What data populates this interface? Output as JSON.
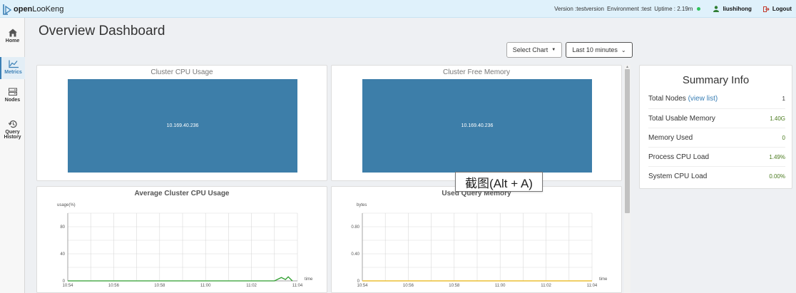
{
  "brand": {
    "name_bold": "open",
    "name_rest": "LooKeng"
  },
  "topbar": {
    "version": "Version :testversion",
    "environment": "Environment :test",
    "uptime": "Uptime : 2.19m",
    "status_color": "#2fc25b",
    "user": "liushihong",
    "logout": "Logout"
  },
  "sidebar": {
    "items": [
      {
        "label": "Home",
        "icon": "home-icon"
      },
      {
        "label": "Metrics",
        "icon": "line-chart-icon",
        "active": true
      },
      {
        "label": "Nodes",
        "icon": "server-icon"
      },
      {
        "label": "Query",
        "label2": "History",
        "icon": "history-icon"
      }
    ]
  },
  "page": {
    "title": "Overview Dashboard"
  },
  "controls": {
    "select_chart": "Select Chart",
    "range": "Last 10 minutes"
  },
  "panels": {
    "cpu_usage": {
      "title": "Cluster CPU Usage",
      "node": "10.169.40.236"
    },
    "free_memory": {
      "title": "Cluster Free Memory",
      "node": "10.169.40.236"
    },
    "avg_cpu": {
      "title": "Average Cluster CPU Usage"
    },
    "used_memory": {
      "title": "Used Query Memory"
    }
  },
  "summary": {
    "title": "Summary Info",
    "rows": [
      {
        "label": "Total Nodes",
        "link": "(view list)",
        "value": "1"
      },
      {
        "label": "Total Usable Memory",
        "value": "1.40G"
      },
      {
        "label": "Memory Used",
        "value": "0"
      },
      {
        "label": "Process CPU Load",
        "value": "1.49%"
      },
      {
        "label": "System CPU Load",
        "value": "0.00%"
      }
    ]
  },
  "tooltip": {
    "text": "截图(Alt + A)"
  },
  "colors": {
    "accent": "#3d7ea9",
    "series_green": "#2e9e2e",
    "series_yellow": "#e8b20c"
  },
  "chart_data": [
    {
      "type": "line",
      "ylabel": "usage(%)",
      "xlabel": "time",
      "x": [
        "10:54",
        "10:56",
        "10:58",
        "11:00",
        "11:02",
        "11:04"
      ],
      "yticks": [
        "0",
        "40",
        "80"
      ],
      "ylim": [
        0,
        100
      ],
      "series": [
        {
          "values": [
            [
              10.9,
              0
            ],
            [
              11.05,
              0
            ],
            [
              11.055,
              5
            ],
            [
              11.058,
              2
            ],
            [
              11.06,
              6
            ],
            [
              11.063,
              0
            ]
          ],
          "color": "#2e9e2e"
        }
      ]
    },
    {
      "type": "line",
      "ylabel": "bytes",
      "xlabel": "time",
      "x": [
        "10:54",
        "10:56",
        "10:58",
        "11:00",
        "11:02",
        "11:04"
      ],
      "yticks": [
        "0",
        "0.40",
        "0.80"
      ],
      "ylim": [
        0,
        1
      ],
      "series": [
        {
          "values": [
            [
              10.9,
              0
            ],
            [
              11.0667,
              0
            ]
          ],
          "color": "#e8b20c"
        }
      ]
    }
  ]
}
